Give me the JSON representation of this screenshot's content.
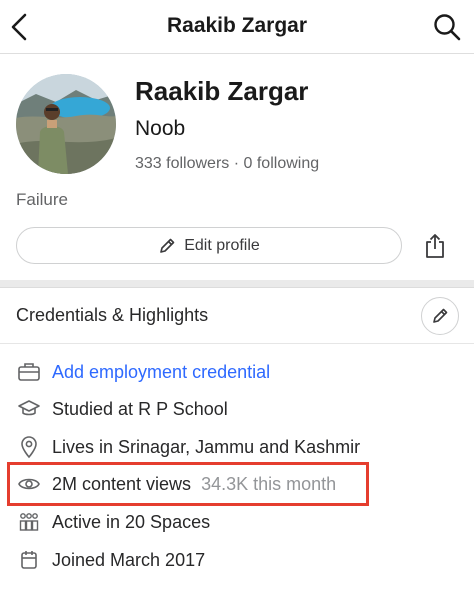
{
  "header": {
    "title": "Raakib Zargar"
  },
  "profile": {
    "name": "Raakib Zargar",
    "tagline": "Noob",
    "followers": "333 followers",
    "separator": "·",
    "following": "0 following",
    "bio": "Failure",
    "edit_label": "Edit profile"
  },
  "credentials": {
    "title": "Credentials & Highlights",
    "items": [
      {
        "icon": "briefcase-icon",
        "text": "Add employment credential",
        "extra": ""
      },
      {
        "icon": "graduation-cap-icon",
        "text": "Studied at R P School",
        "extra": ""
      },
      {
        "icon": "location-pin-icon",
        "text": "Lives in Srinagar, Jammu and Kashmir",
        "extra": ""
      },
      {
        "icon": "eye-icon",
        "text": "2M content views",
        "extra": "34.3K this month"
      },
      {
        "icon": "spaces-icon",
        "text": "Active in 20 Spaces",
        "extra": ""
      },
      {
        "icon": "calendar-icon",
        "text": "Joined March 2017",
        "extra": ""
      }
    ]
  },
  "colors": {
    "link": "#2e69ff",
    "highlight": "#e53d2e",
    "muted": "#939598"
  }
}
